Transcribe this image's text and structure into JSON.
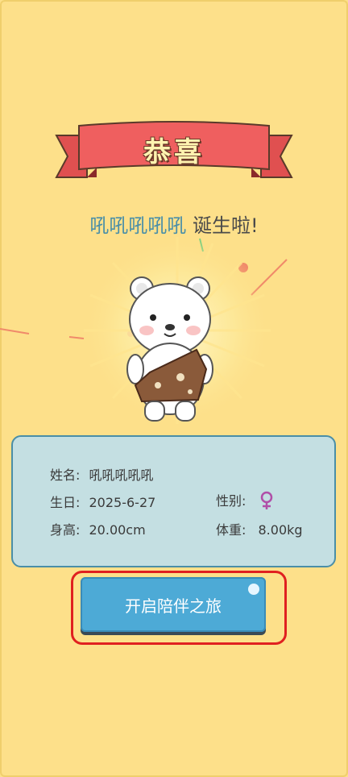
{
  "banner": {
    "title": "恭喜"
  },
  "born": {
    "name": "吼吼吼吼吼",
    "suffix": " 诞生啦!"
  },
  "info": {
    "name_label": "姓名:",
    "name_value": "吼吼吼吼吼",
    "birthday_label": "生日:",
    "birthday_value": "2025-6-27",
    "gender_label": "性别:",
    "gender_icon": "female-icon",
    "height_label": "身高:",
    "height_value": "20.00cm",
    "weight_label": "体重:",
    "weight_value": "8.00kg"
  },
  "action": {
    "start_label": "开启陪伴之旅"
  },
  "colors": {
    "background": "#fde08a",
    "ribbon": "#e85a5a",
    "card": "#c4dfe2",
    "card_border": "#4a8ea7",
    "button": "#4daad6",
    "highlight": "#e02020",
    "female_symbol": "#b04fa8"
  }
}
